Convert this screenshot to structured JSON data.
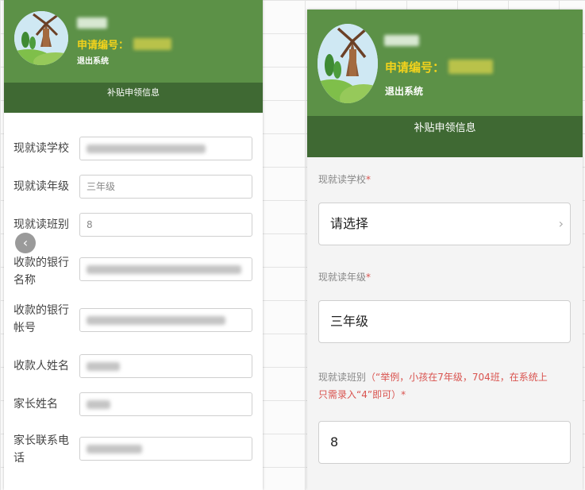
{
  "left": {
    "header": {
      "application_label": "申请编号：",
      "logout": "退出系统"
    },
    "tab": "补贴申领信息",
    "back_icon": "‹",
    "fields": [
      {
        "label_lines": [
          "现就读学校"
        ],
        "value": ""
      },
      {
        "label_lines": [
          "现就读年级"
        ],
        "value": "三年级"
      },
      {
        "label_lines": [
          "现就读班别"
        ],
        "value": "8"
      },
      {
        "label_lines": [
          "收款的银行",
          "名称"
        ],
        "value": ""
      },
      {
        "label_lines": [
          "收款的银行",
          "帐号"
        ],
        "value": ""
      },
      {
        "label_lines": [
          "收款人姓名"
        ],
        "value": ""
      },
      {
        "label_lines": [
          "家长姓名"
        ],
        "value": ""
      },
      {
        "label_lines": [
          "家长联系电",
          "话"
        ],
        "value": ""
      }
    ]
  },
  "right": {
    "header": {
      "application_label": "申请编号：",
      "logout": "退出系统"
    },
    "tab": "补贴申领信息",
    "school": {
      "label": "现就读学校",
      "required": "*",
      "value": "请选择",
      "chevron": "›"
    },
    "grade": {
      "label": "现就读年级",
      "required": "*",
      "value": "三年级"
    },
    "class": {
      "label": "现就读班别",
      "hint_line1": "（“举例，小孩在7年级，704班，在系统上",
      "hint_line2": "只需录入“4”即可）",
      "required": "*",
      "value": "8"
    }
  },
  "colors": {
    "header_green": "#5c9147",
    "tab_dark_green": "#3f6933",
    "app_no_yellow": "#f2d21c",
    "required_red": "#d9534f"
  }
}
